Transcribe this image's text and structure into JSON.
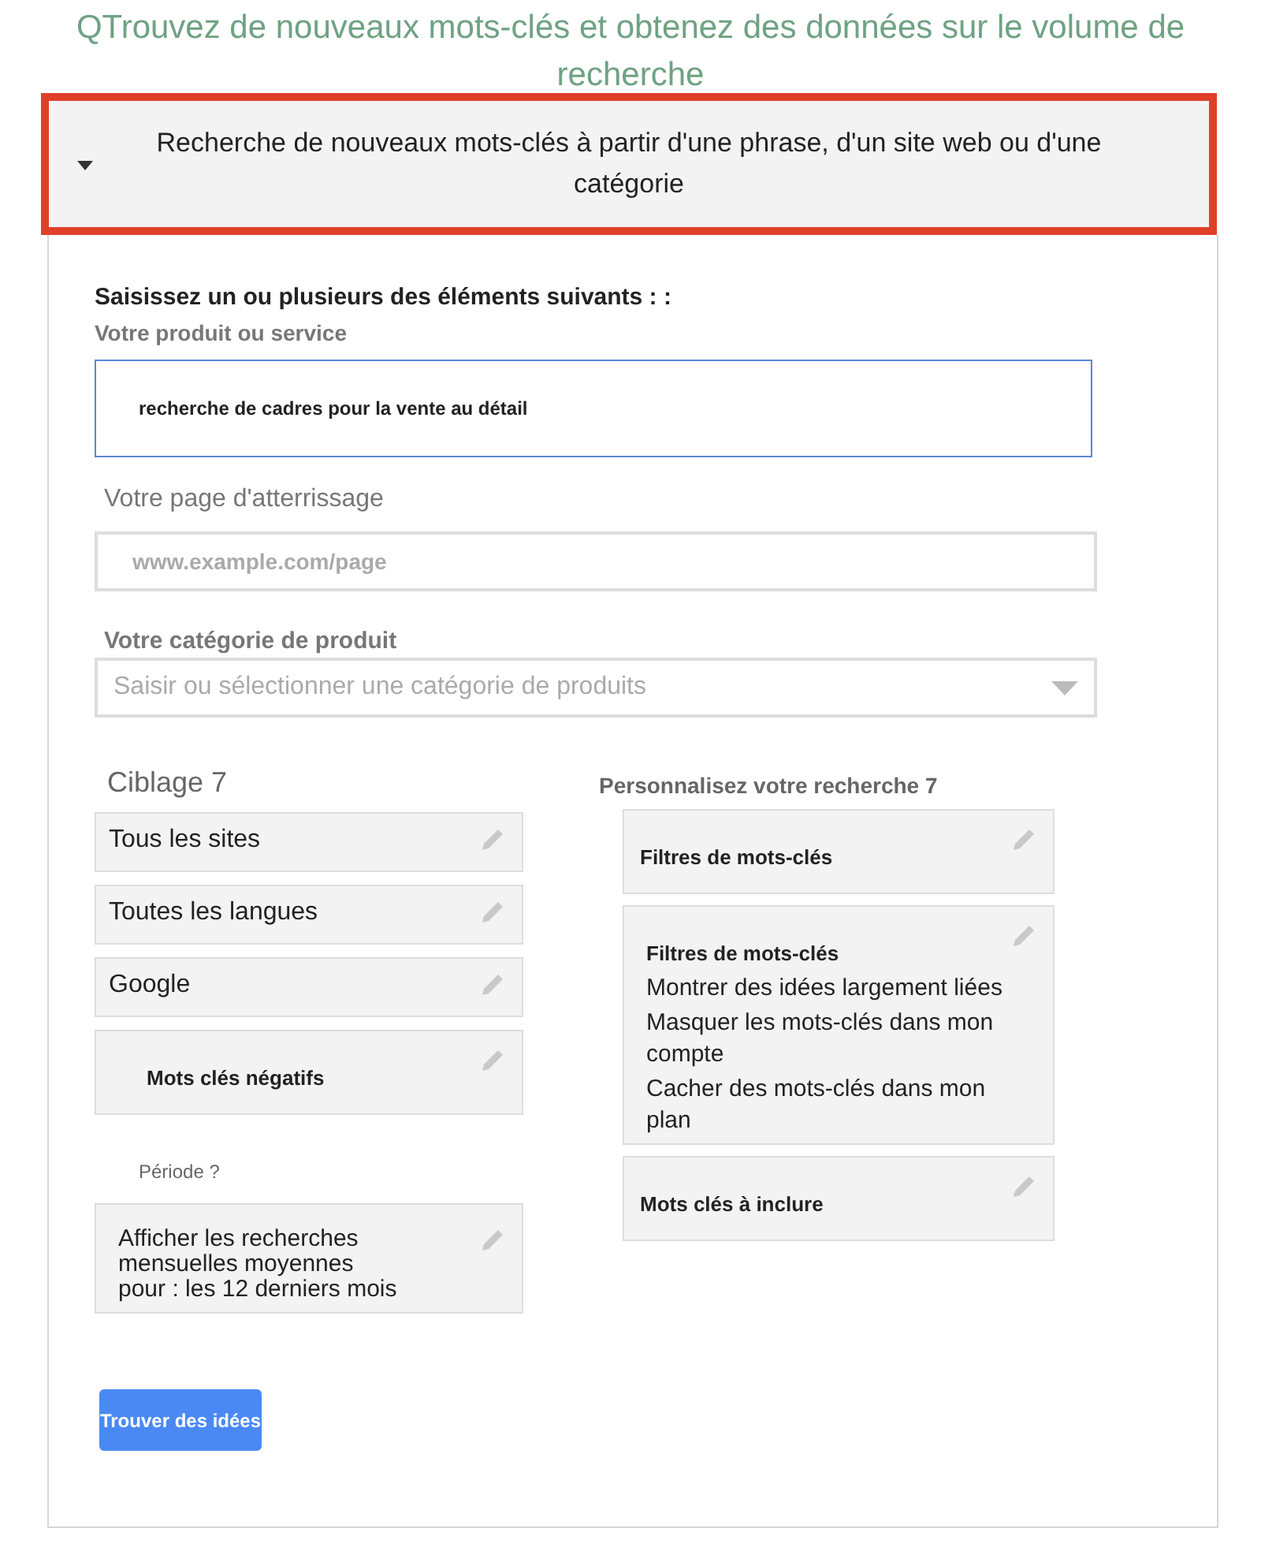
{
  "title": "QTrouvez de nouveaux mots-clés et obtenez des données sur le volume de recherche",
  "section": {
    "label": "Recherche de nouveaux mots-clés à partir d'une phrase, d'un site web ou d'une catégorie",
    "expanded": true
  },
  "form": {
    "heading": "Saisissez un ou plusieurs des éléments suivants : :",
    "product_label": "Votre produit ou service",
    "product_value": "recherche de cadres pour la vente au détail",
    "landing_label": "Votre page d'atterrissage",
    "landing_placeholder": "www.example.com/page",
    "category_label": "Votre catégorie de produit",
    "category_placeholder": "Saisir ou sélectionner une catégorie de produits"
  },
  "targeting": {
    "title": "Ciblage 7",
    "items": [
      {
        "kind": "plain",
        "label": "Tous les sites"
      },
      {
        "kind": "plain",
        "label": "Toutes les langues"
      },
      {
        "kind": "plain",
        "label": "Google"
      },
      {
        "kind": "bold",
        "label": "Mots clés négatifs"
      }
    ]
  },
  "period": {
    "label": "Période ?",
    "value": "Afficher les recherches mensuelles moyennes pour : les 12 derniers mois"
  },
  "customize": {
    "title": "Personnalisez votre recherche 7",
    "items": [
      {
        "kind": "bold",
        "label": "Filtres de mots-clés"
      },
      {
        "kind": "list",
        "label": "Filtres de mots-clés",
        "lines": [
          "Montrer des idées largement liées",
          "Masquer les mots-clés dans mon compte",
          "Cacher des mots-clés dans mon plan"
        ]
      },
      {
        "kind": "bold",
        "label": "Mots clés à inclure"
      }
    ]
  },
  "button": "Trouver des idées"
}
